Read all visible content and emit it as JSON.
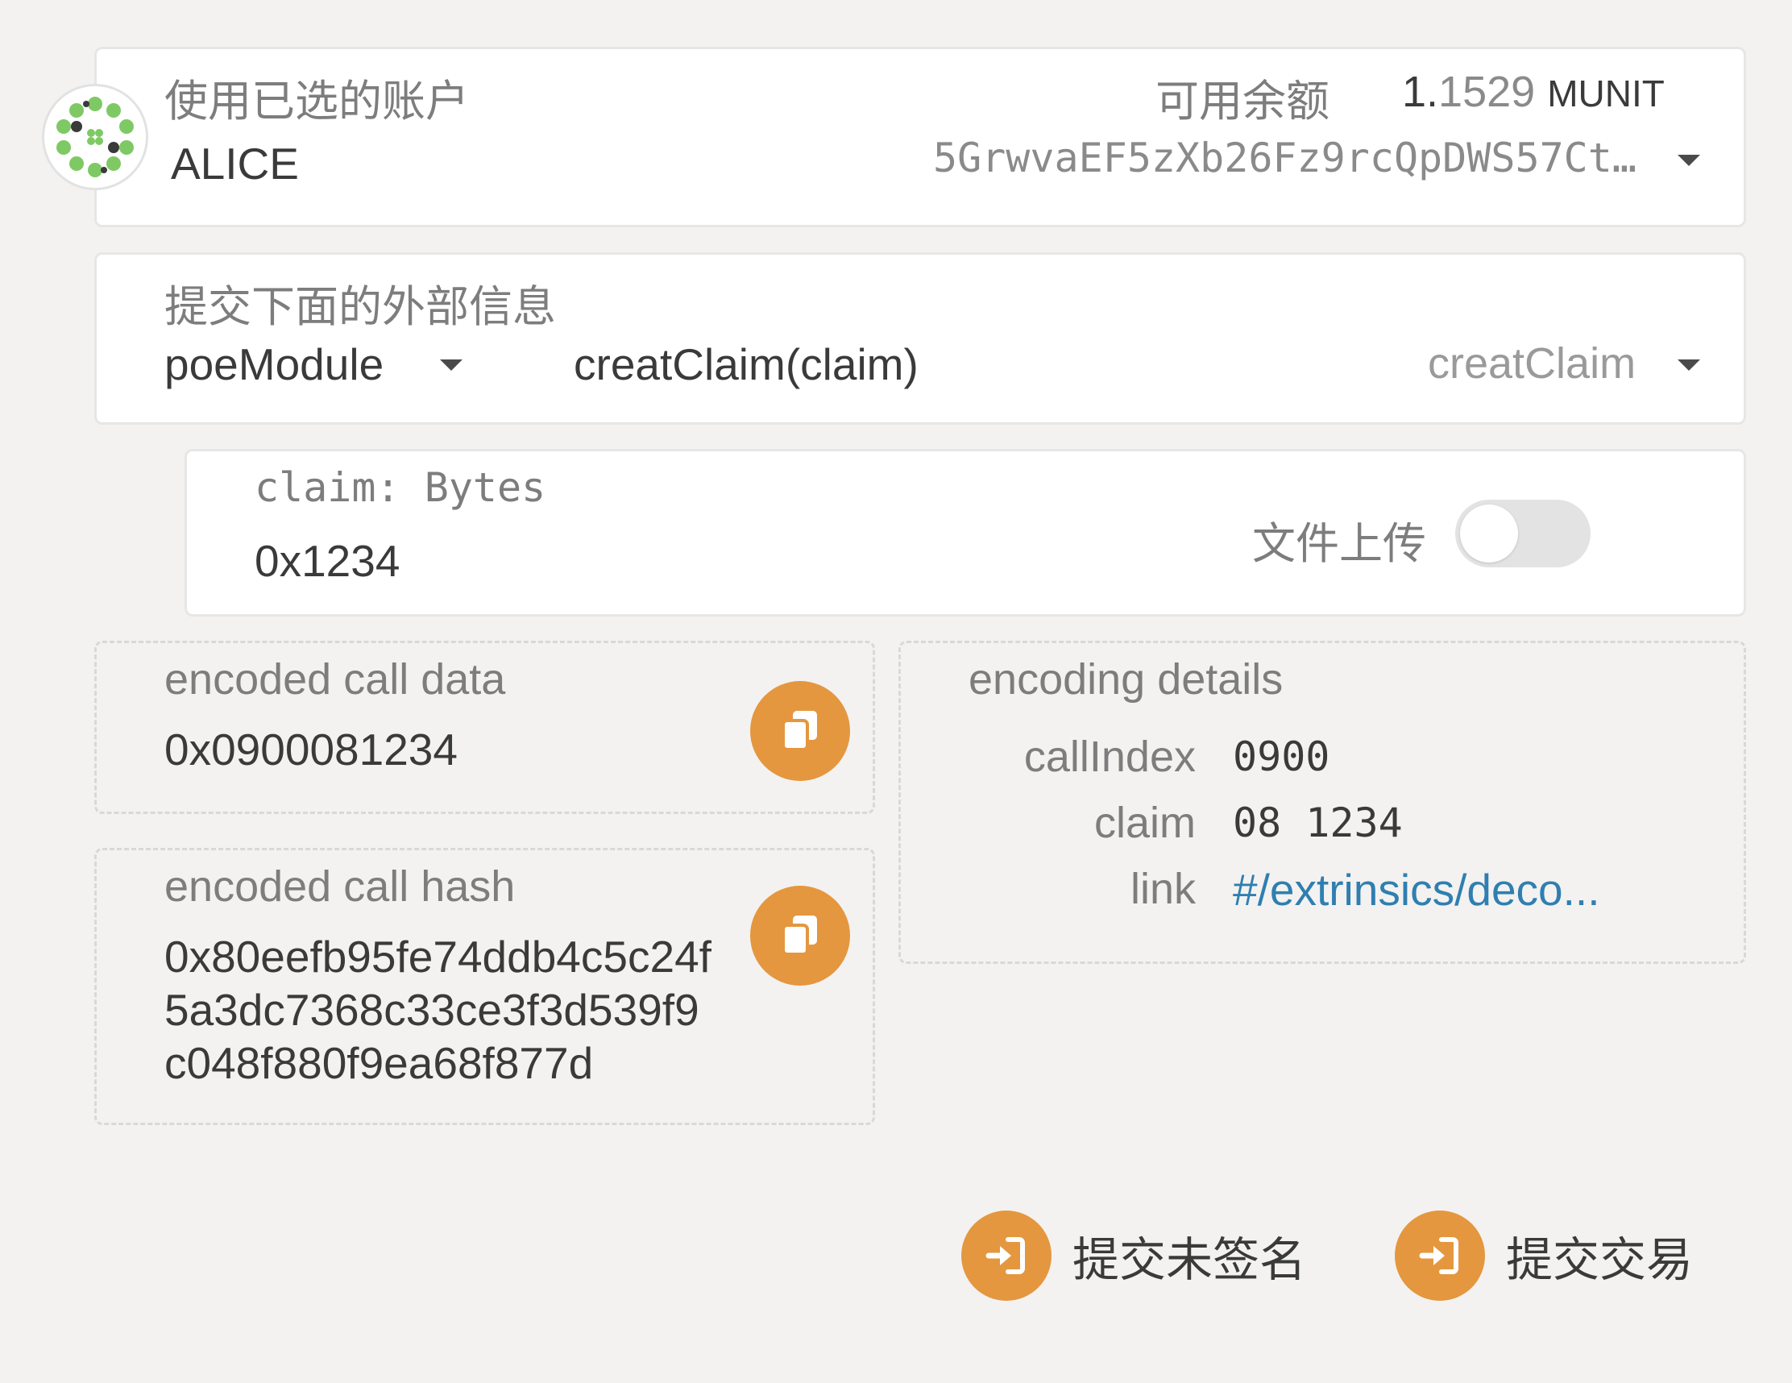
{
  "account": {
    "label": "使用已选的账户",
    "name": "ALICE",
    "balance_label": "可用余额",
    "balance_int": "1.",
    "balance_dec": "1529",
    "balance_unit": "MUNIT",
    "address": "5GrwvaEF5zXb26Fz9rcQpDWS57Ct…"
  },
  "extrinsic": {
    "label": "提交下面的外部信息",
    "module": "poeModule",
    "call_signature": "creatClaim(claim)",
    "call_selected": "creatClaim"
  },
  "param": {
    "label": "claim: Bytes",
    "value": "0x1234",
    "upload_label": "文件上传",
    "upload_enabled": false
  },
  "encoded_call_data": {
    "label": "encoded call data",
    "value": "0x0900081234"
  },
  "encoded_call_hash": {
    "label": "encoded call hash",
    "line1": "0x80eefb95fe74ddb4c5c24f",
    "line2": "5a3dc7368c33ce3f3d539f9",
    "line3": "c048f880f9ea68f877d"
  },
  "encoding_details": {
    "label": "encoding details",
    "rows": [
      {
        "key": "callIndex",
        "value": "0900"
      },
      {
        "key": "claim",
        "value": "08 1234"
      },
      {
        "key": "link",
        "value": "#/extrinsics/deco..."
      }
    ]
  },
  "actions": {
    "submit_unsigned": "提交未签名",
    "submit_transaction": "提交交易"
  },
  "colors": {
    "accent": "#e4973f",
    "link": "#2f7fb0",
    "identicon_green": "#7ec964"
  },
  "icons": {
    "copy": "copy-icon",
    "sign_in": "sign-in-icon",
    "dropdown": "caret-down-icon",
    "identicon": "identicon"
  }
}
